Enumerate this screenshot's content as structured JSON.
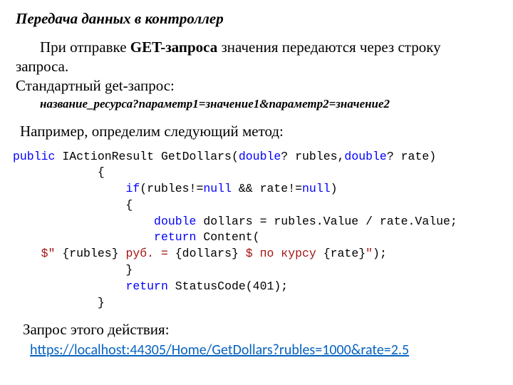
{
  "title": "Передача данных в контроллер",
  "p1_a": "При отправке ",
  "p1_b": "GET-запроса",
  "p1_c": " значения передаются через строку запроса.",
  "p2": "Стандартный get-запрос:",
  "url_pattern": "название_ресурса?параметр1=значение1&параметр2=значение2",
  "example_intro": "Например, определим следующий метод:",
  "code": {
    "l1_a": "public",
    "l1_b": " IActionResult GetDollars(",
    "l1_c": "double",
    "l1_d": "? rubles,",
    "l1_e": "double",
    "l1_f": "? rate)",
    "l2": "            {",
    "l3_a": "                ",
    "l3_b": "if",
    "l3_c": "(rubles!=",
    "l3_d": "null",
    "l3_e": " && rate!=",
    "l3_f": "null",
    "l3_g": ")",
    "l4": "                {",
    "l5_a": "                    ",
    "l5_b": "double",
    "l5_c": " dollars = rubles.Value / rate.Value;",
    "l6_a": "                    ",
    "l6_b": "return",
    "l6_c": " Content(",
    "l7_a": "    ",
    "l7_b": "$\" ",
    "l7_c": "{rubles}",
    "l7_d": " руб. = ",
    "l7_e": "{dollars}",
    "l7_f": " $ по курсу ",
    "l7_g": "{rate}",
    "l7_h": "\"",
    "l7_i": ");",
    "l8": "                }",
    "l9_a": "                ",
    "l9_b": "return",
    "l9_c": " StatusCode(401);",
    "l10": "            }"
  },
  "request_intro": "Запрос этого действия:",
  "link": "https://localhost:44305/Home/GetDollars?rubles=1000&rate=2.5"
}
